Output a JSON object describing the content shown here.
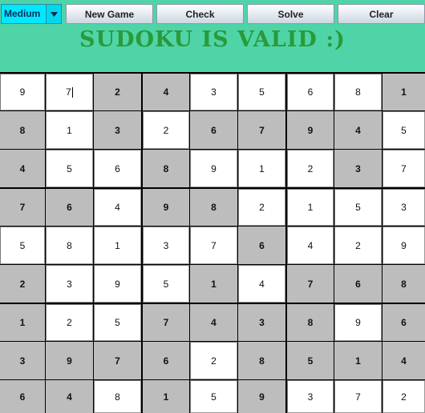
{
  "toolbar": {
    "difficulty_value": "Medium",
    "new_game_label": "New Game",
    "check_label": "Check",
    "solve_label": "Solve",
    "clear_label": "Clear"
  },
  "status": {
    "message": "SUDOKU IS VALID :)"
  },
  "colors": {
    "background": "#4fd4a7",
    "status_text": "#2a9a3a",
    "given_cell": "#bdbdbd",
    "input_cell": "#ffffff",
    "dropdown": "#00e8ff"
  },
  "board": {
    "values": [
      [
        9,
        7,
        2,
        4,
        3,
        5,
        6,
        8,
        1
      ],
      [
        8,
        1,
        3,
        2,
        6,
        7,
        9,
        4,
        5
      ],
      [
        4,
        5,
        6,
        8,
        9,
        1,
        2,
        3,
        7
      ],
      [
        7,
        6,
        4,
        9,
        8,
        2,
        1,
        5,
        3
      ],
      [
        5,
        8,
        1,
        3,
        7,
        6,
        4,
        2,
        9
      ],
      [
        2,
        3,
        9,
        5,
        1,
        4,
        7,
        6,
        8
      ],
      [
        1,
        2,
        5,
        7,
        4,
        3,
        8,
        9,
        6
      ],
      [
        3,
        9,
        7,
        6,
        2,
        8,
        5,
        1,
        4
      ],
      [
        6,
        4,
        8,
        1,
        5,
        9,
        3,
        7,
        2
      ]
    ],
    "given": [
      [
        0,
        0,
        1,
        1,
        0,
        0,
        0,
        0,
        1
      ],
      [
        1,
        0,
        1,
        0,
        1,
        1,
        1,
        1,
        0
      ],
      [
        1,
        0,
        0,
        1,
        0,
        0,
        0,
        1,
        0
      ],
      [
        1,
        1,
        0,
        1,
        1,
        0,
        0,
        0,
        0
      ],
      [
        0,
        0,
        0,
        0,
        0,
        1,
        0,
        0,
        0
      ],
      [
        1,
        0,
        0,
        0,
        1,
        0,
        1,
        1,
        1
      ],
      [
        1,
        0,
        0,
        1,
        1,
        1,
        1,
        0,
        1
      ],
      [
        1,
        1,
        1,
        1,
        0,
        1,
        1,
        1,
        1
      ],
      [
        1,
        1,
        0,
        1,
        0,
        1,
        0,
        0,
        0
      ]
    ],
    "focused_cell": [
      0,
      1
    ]
  }
}
